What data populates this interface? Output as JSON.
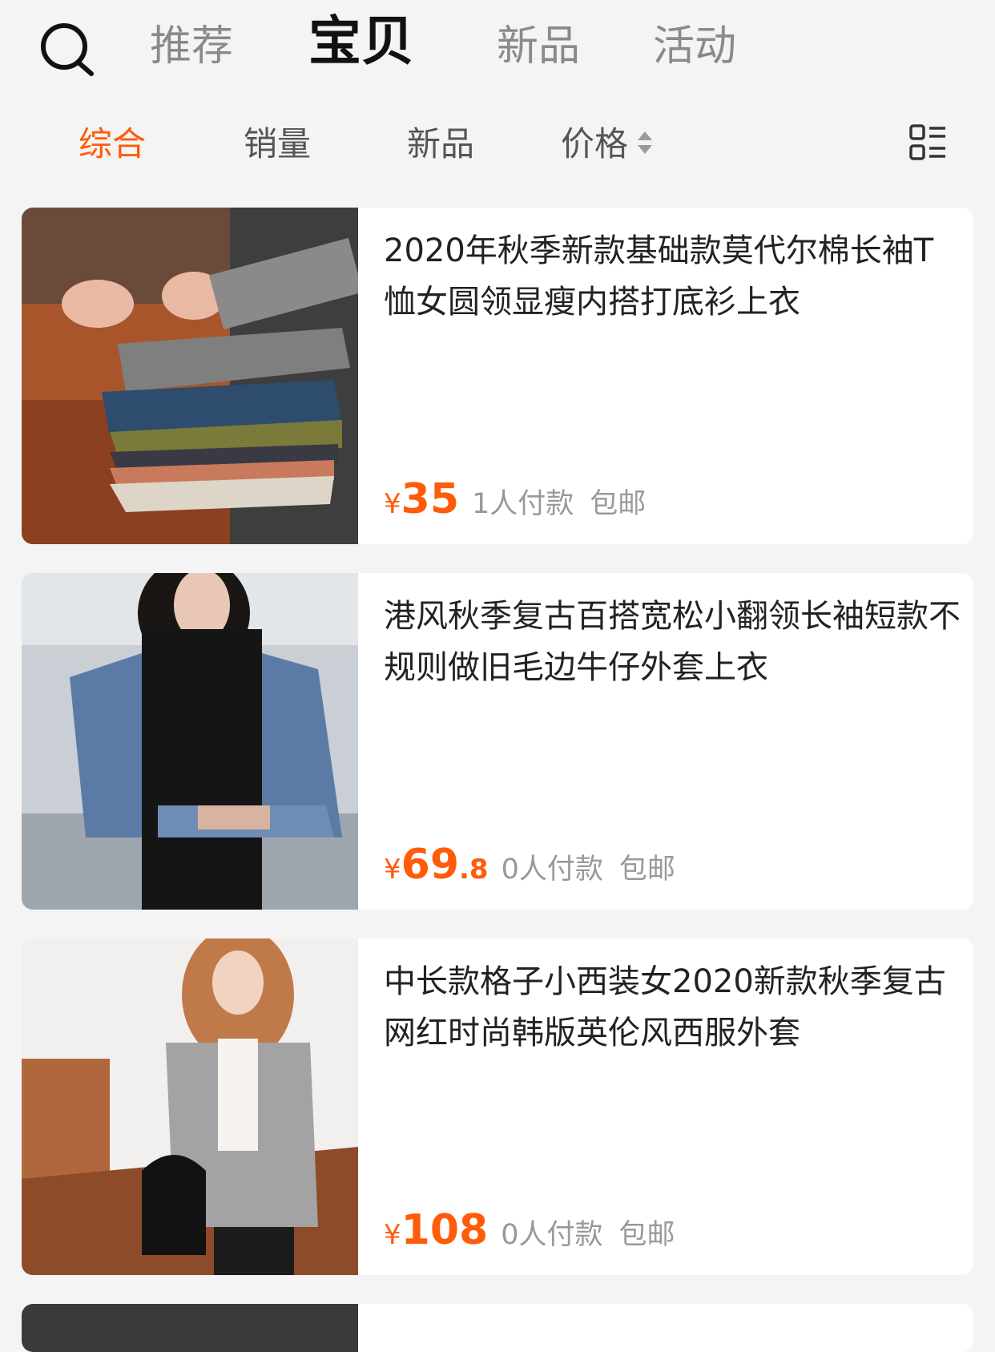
{
  "header": {
    "tabs": [
      {
        "label": "推荐",
        "active": false
      },
      {
        "label": "宝贝",
        "active": true
      },
      {
        "label": "新品",
        "active": false
      },
      {
        "label": "活动",
        "active": false
      }
    ],
    "search_icon": "search-icon"
  },
  "filters": {
    "items": [
      {
        "label": "综合",
        "active": true
      },
      {
        "label": "销量",
        "active": false
      },
      {
        "label": "新品",
        "active": false
      },
      {
        "label": "价格",
        "active": false
      }
    ],
    "sort_icon": "sort-arrows-icon",
    "layout_icon": "list-layout-icon"
  },
  "colors": {
    "accent": "#ff5b0a",
    "background": "#f4f4f4"
  },
  "products": [
    {
      "title": "2020年秋季新款基础款莫代尔棉长袖T恤女圆领显瘦内搭打底衫上衣",
      "currency": "¥",
      "price_int": "35",
      "price_dec": "",
      "sales": "1人付款",
      "shipping": "包邮"
    },
    {
      "title": "港风秋季复古百搭宽松小翻领长袖短款不规则做旧毛边牛仔外套上衣",
      "currency": "¥",
      "price_int": "69",
      "price_dec": ".8",
      "sales": "0人付款",
      "shipping": "包邮"
    },
    {
      "title": "中长款格子小西装女2020新款秋季复古网红时尚韩版英伦风西服外套",
      "currency": "¥",
      "price_int": "108",
      "price_dec": "",
      "sales": "0人付款",
      "shipping": "包邮"
    }
  ]
}
